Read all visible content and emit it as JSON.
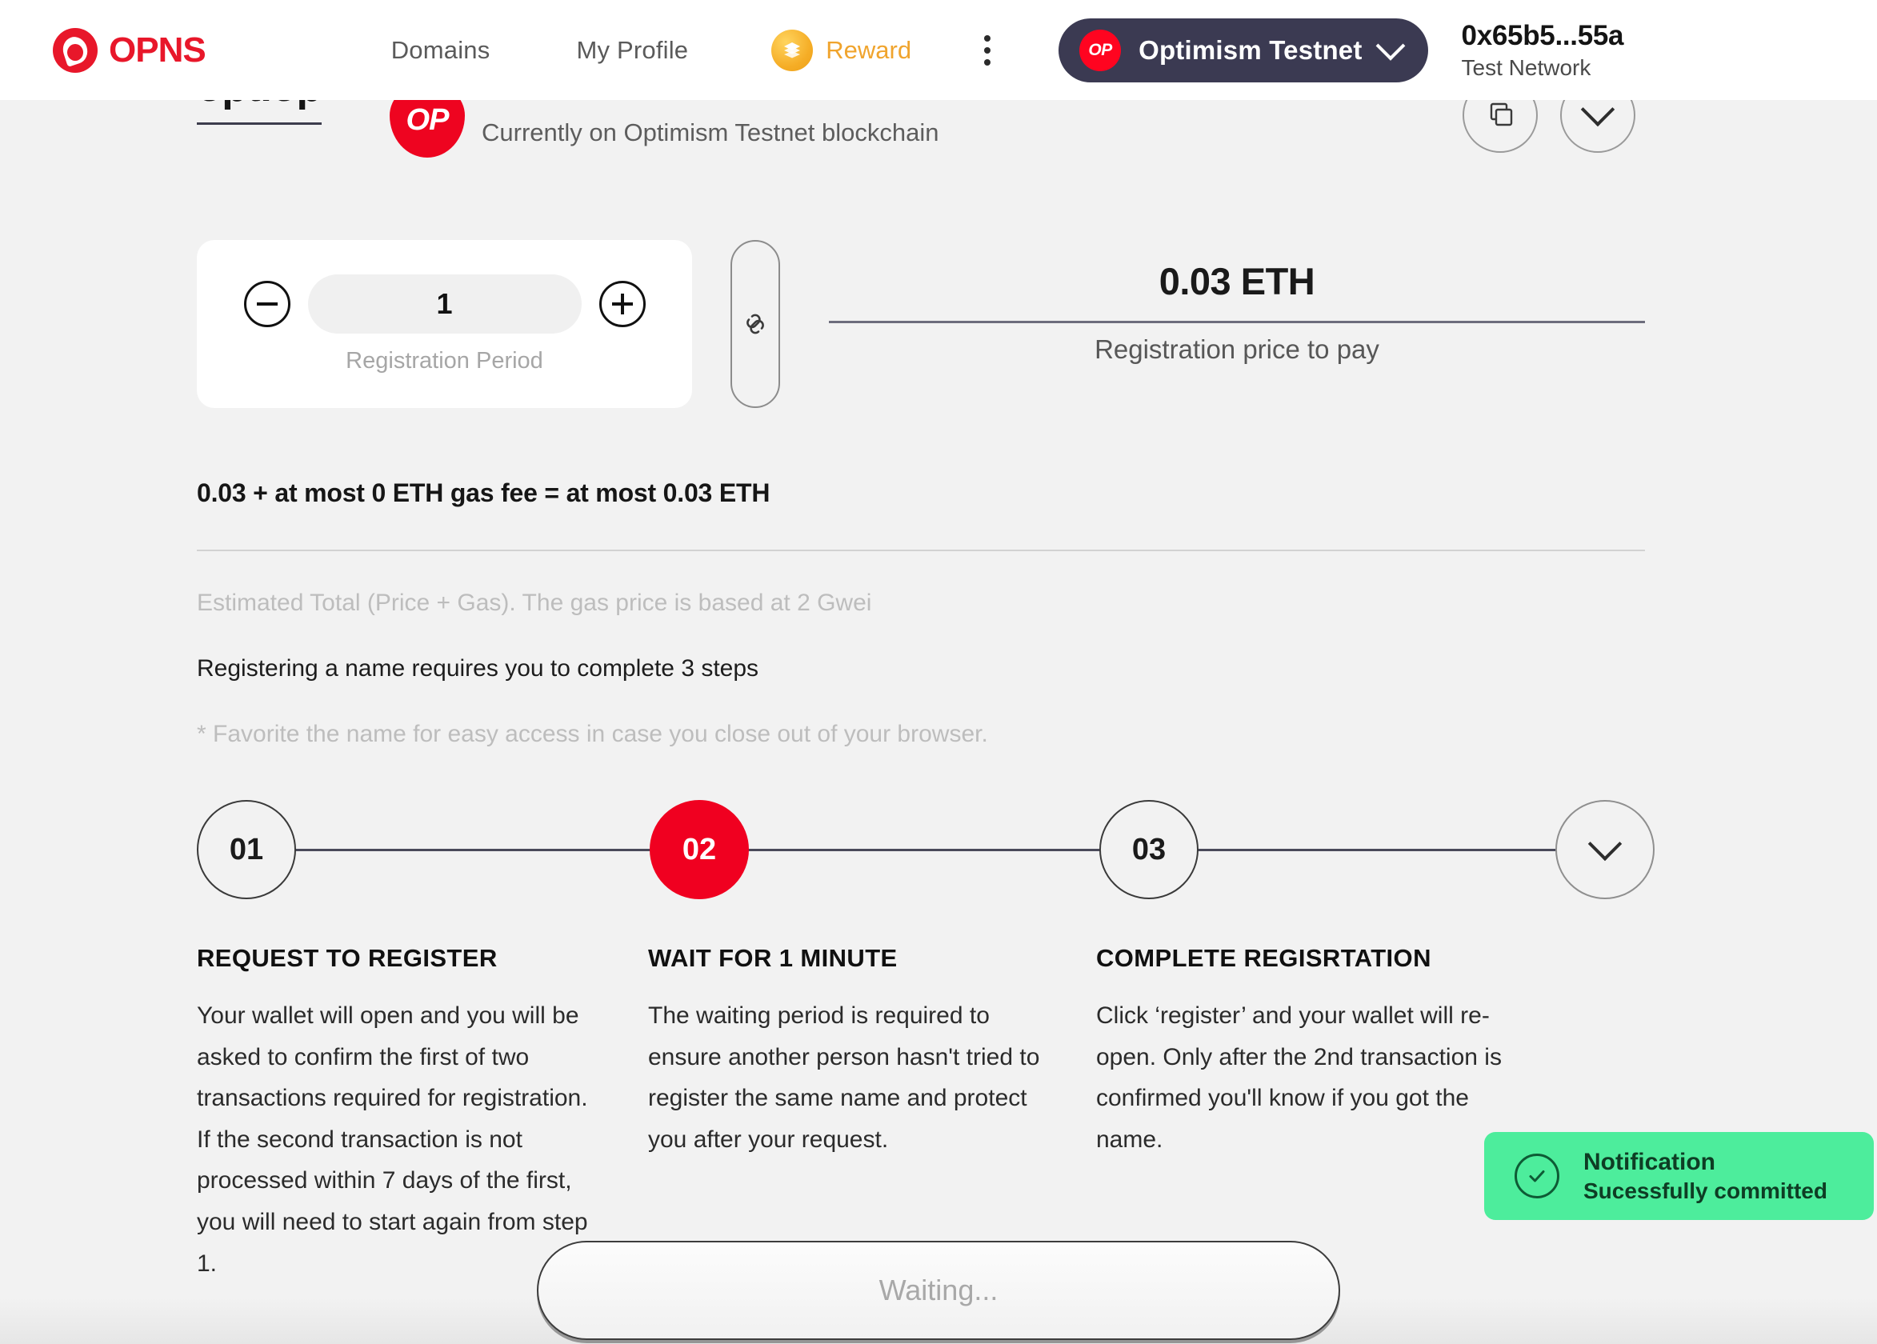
{
  "header": {
    "brand": {
      "name": "OPNS",
      "icon": "opns-logo-icon"
    },
    "nav": [
      {
        "label": "Domains",
        "name": "nav-domains"
      },
      {
        "label": "My Profile",
        "name": "nav-my-profile"
      }
    ],
    "reward": {
      "label": "Reward",
      "icon": "reward-coin-icon",
      "color": "#f0a42d"
    },
    "menu_icon": "kebab-menu-icon",
    "network": {
      "chip": "OP",
      "label": "Optimism Testnet",
      "chevron": "chevron-down-icon",
      "pill_color": "#3b3a52",
      "chip_color": "#ff0420"
    },
    "account": {
      "address": "0x65b5...55a",
      "subtitle": "Test Network"
    }
  },
  "title_row": {
    "domain": "opt.op",
    "op_badge": "OP",
    "chain_note": "Currently on Optimism Testnet blockchain",
    "copy_icon": "copy-icon",
    "expand_icon": "chevron-down-icon"
  },
  "price_row": {
    "period": {
      "decrement_icon": "minus-icon",
      "increment_icon": "plus-icon",
      "value": "1",
      "label": "Registration Period"
    },
    "link_icon": "link-chain-icon",
    "price": {
      "amount": "0.03 ETH",
      "caption": "Registration price to pay"
    }
  },
  "summary": {
    "total": "0.03 + at most 0 ETH gas fee = at most 0.03 ETH",
    "estimate_note": "Estimated Total (Price + Gas). The gas price is based at 2 Gwei",
    "steps_note": "Registering a name requires you to complete 3 steps",
    "favorite_note": "* Favorite the name for easy access in case you close out of your browser."
  },
  "steps": {
    "nodes": [
      {
        "label": "01",
        "active": false
      },
      {
        "label": "02",
        "active": true
      },
      {
        "label": "03",
        "active": false
      }
    ],
    "end_icon": "chevron-down-icon",
    "active_color": "#f00020",
    "columns": [
      {
        "title": "REQUEST TO REGISTER",
        "body": "Your wallet will open and you will be asked to confirm the first of two transactions required for registration. If the second transaction is not processed within 7 days of the first, you will need to start again from step 1."
      },
      {
        "title": "WAIT FOR 1 MINUTE",
        "body": "The waiting period is required to ensure another person hasn't tried to register the same name and protect you after your request."
      },
      {
        "title": "COMPLETE REGISRTATION",
        "body": "Click ‘register’ and your wallet will re-open. Only after the 2nd transaction is confirmed you'll know if you got the name."
      }
    ]
  },
  "toast": {
    "icon": "check-circle-icon",
    "title": "Notification",
    "message": "Sucessfully committed",
    "background": "#4ded9c"
  },
  "action": {
    "label": "Waiting..."
  }
}
